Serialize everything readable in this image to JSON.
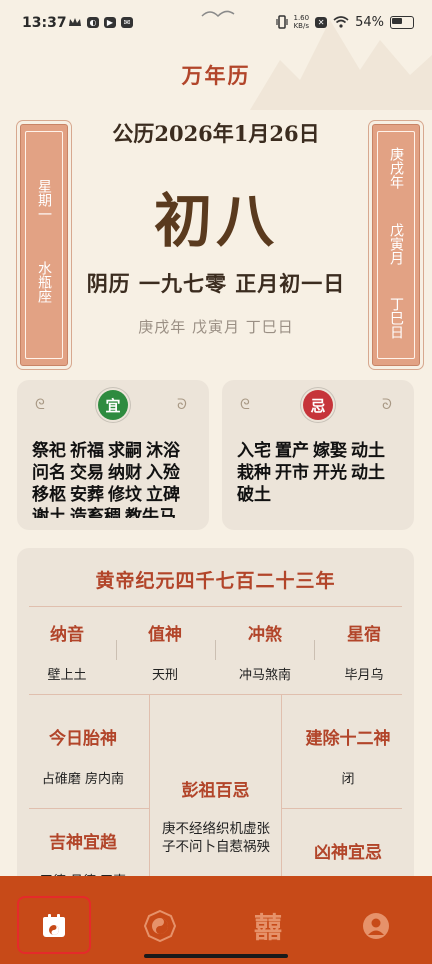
{
  "status_bar": {
    "time": "13:37",
    "speed_value": "1.60",
    "speed_unit": "KB/s",
    "battery": "54%"
  },
  "app_title": "万年历",
  "solar_date": "公历2026年1月26日",
  "lunar_day_big": "初八",
  "lunar_full": "阴历 一九七零 正月初一日",
  "ganzhi_line": "庚戌年  戊寅月  丁巳日",
  "left_banner": {
    "weekday": "星期一",
    "zodiac": "水瓶座"
  },
  "right_banner": {
    "year": "庚戌年",
    "month": "戊寅月",
    "day": "丁巳日"
  },
  "yi": {
    "label": "宜",
    "items": [
      "祭祀",
      "祈福",
      "求嗣",
      "沐浴",
      "问名",
      "交易",
      "纳财",
      "入殓",
      "移柩",
      "安葬",
      "修坟",
      "立碑",
      "谢土",
      "造畜稠",
      "教牛马"
    ]
  },
  "ji": {
    "label": "忌",
    "items": [
      "入宅",
      "置产",
      "嫁娶",
      "动土",
      "栽种",
      "开市",
      "开光",
      "动土",
      "破土"
    ]
  },
  "era": "黄帝纪元四千七百二十三年",
  "four_cols": [
    {
      "title": "纳音",
      "value": "壁上土"
    },
    {
      "title": "值神",
      "value": "天刑"
    },
    {
      "title": "冲煞",
      "value": "冲马煞南"
    },
    {
      "title": "星宿",
      "value": "毕月乌"
    }
  ],
  "taishen": {
    "title": "今日胎神",
    "value": "占碓磨 房内南"
  },
  "pengzu": {
    "title": "彭祖百忌",
    "value": "庚不经络织机虚张子不问卜自惹祸殃"
  },
  "jianchu": {
    "title": "建除十二神",
    "value": "闭"
  },
  "jishen": {
    "title": "吉神宜趋",
    "value": "天德 月德 天喜"
  },
  "xiongshen": {
    "title": "凶神宜忌"
  },
  "colors": {
    "accent": "#b2452a",
    "nav": "#c74a18",
    "yi_badge": "#2e8b3f",
    "ji_badge": "#c6343a"
  },
  "nav": [
    {
      "name": "calendar",
      "icon": "calendar-icon",
      "selected": true
    },
    {
      "name": "bagua",
      "icon": "yin-yang-icon"
    },
    {
      "name": "double-happiness",
      "icon": "double-happiness-icon"
    },
    {
      "name": "profile",
      "icon": "user-icon"
    }
  ]
}
